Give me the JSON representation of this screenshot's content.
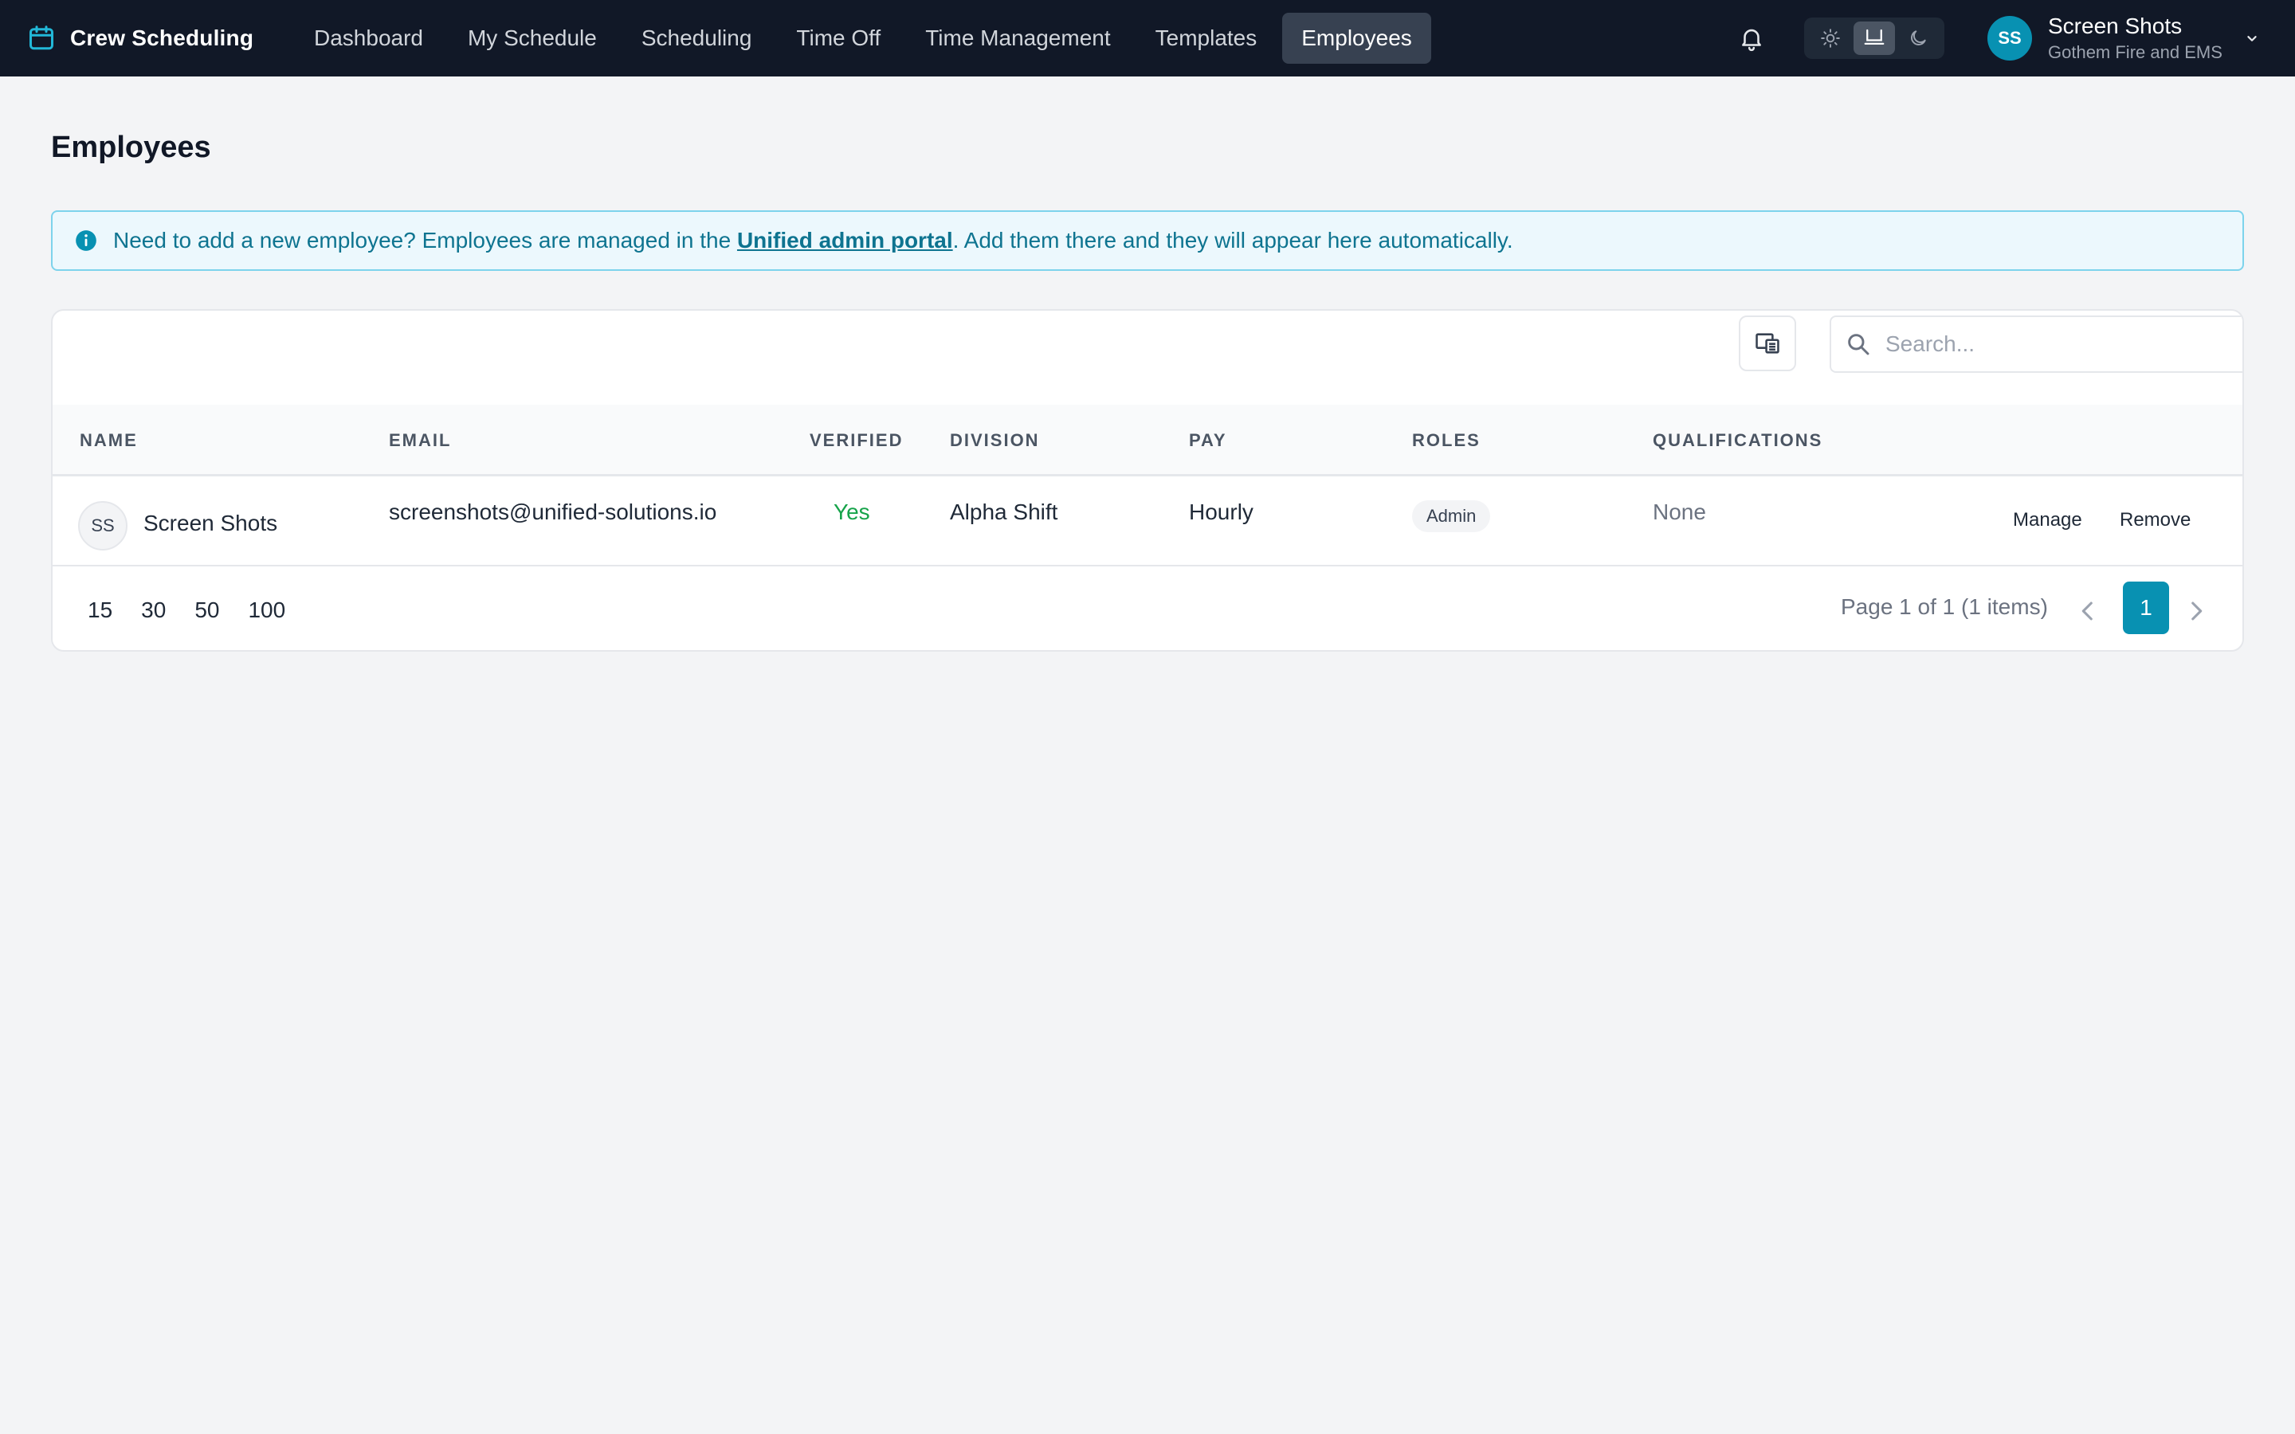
{
  "app": {
    "name": "Crew Scheduling"
  },
  "nav": {
    "items": [
      {
        "label": "Dashboard"
      },
      {
        "label": "My Schedule"
      },
      {
        "label": "Scheduling"
      },
      {
        "label": "Time Off"
      },
      {
        "label": "Time Management"
      },
      {
        "label": "Templates"
      },
      {
        "label": "Employees"
      }
    ],
    "active": "Employees"
  },
  "user": {
    "initials": "SS",
    "name": "Screen Shots",
    "org": "Gothem Fire and EMS"
  },
  "page": {
    "title": "Employees"
  },
  "banner": {
    "text_before": "Need to add a new employee? Employees are managed in the ",
    "link": "Unified admin portal",
    "text_after": ". Add them there and they will appear here automatically."
  },
  "search": {
    "placeholder": "Search..."
  },
  "table": {
    "columns": [
      "NAME",
      "EMAIL",
      "VERIFIED",
      "DIVISION",
      "PAY",
      "ROLES",
      "QUALIFICATIONS"
    ],
    "rows": [
      {
        "initials": "SS",
        "name": "Screen Shots",
        "email": "screenshots@unified-solutions.io",
        "verified": "Yes",
        "division": "Alpha Shift",
        "pay": "Hourly",
        "role": "Admin",
        "qualifications": "None",
        "actions": [
          "Manage",
          "Remove"
        ]
      }
    ]
  },
  "pagination": {
    "page_sizes": [
      "15",
      "30",
      "50",
      "100"
    ],
    "summary": "Page 1 of 1 (1 items)",
    "current": "1"
  },
  "colors": {
    "nav_bg": "#111827",
    "accent": "#0891b2",
    "verified": "#16a34a"
  }
}
